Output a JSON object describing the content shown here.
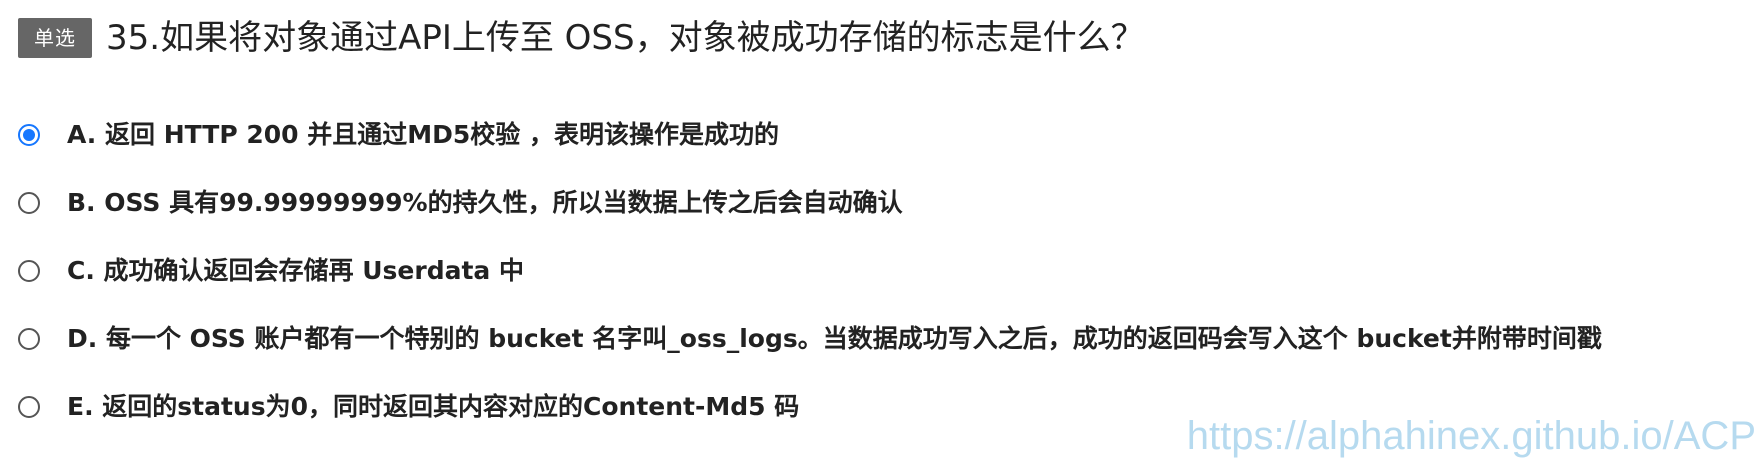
{
  "question": {
    "type_label": "单选",
    "text": "35.如果将对象通过API上传至 OSS，对象被成功存储的标志是什么？"
  },
  "options": [
    {
      "label": "A. 返回 HTTP 200 并且通过MD5校验 ，表明该操作是成功的",
      "selected": true
    },
    {
      "label": "B. OSS 具有99.99999999%的持久性，所以当数据上传之后会自动确认",
      "selected": false
    },
    {
      "label": "C. 成功确认返回会存储再 Userdata 中",
      "selected": false
    },
    {
      "label": "D. 每一个 OSS 账户都有一个特别的 bucket 名字叫_oss_logs。当数据成功写入之后，成功的返回码会写入这个 bucket并附带时间戳",
      "selected": false
    },
    {
      "label": "E. 返回的status为0，同时返回其内容对应的Content-Md5 码",
      "selected": false
    }
  ],
  "watermark": "https://alphahinex.github.io/ACP",
  "colors": {
    "badge_bg": "#666666",
    "radio_selected": "#1677ff",
    "watermark": "#b3d9ef"
  }
}
